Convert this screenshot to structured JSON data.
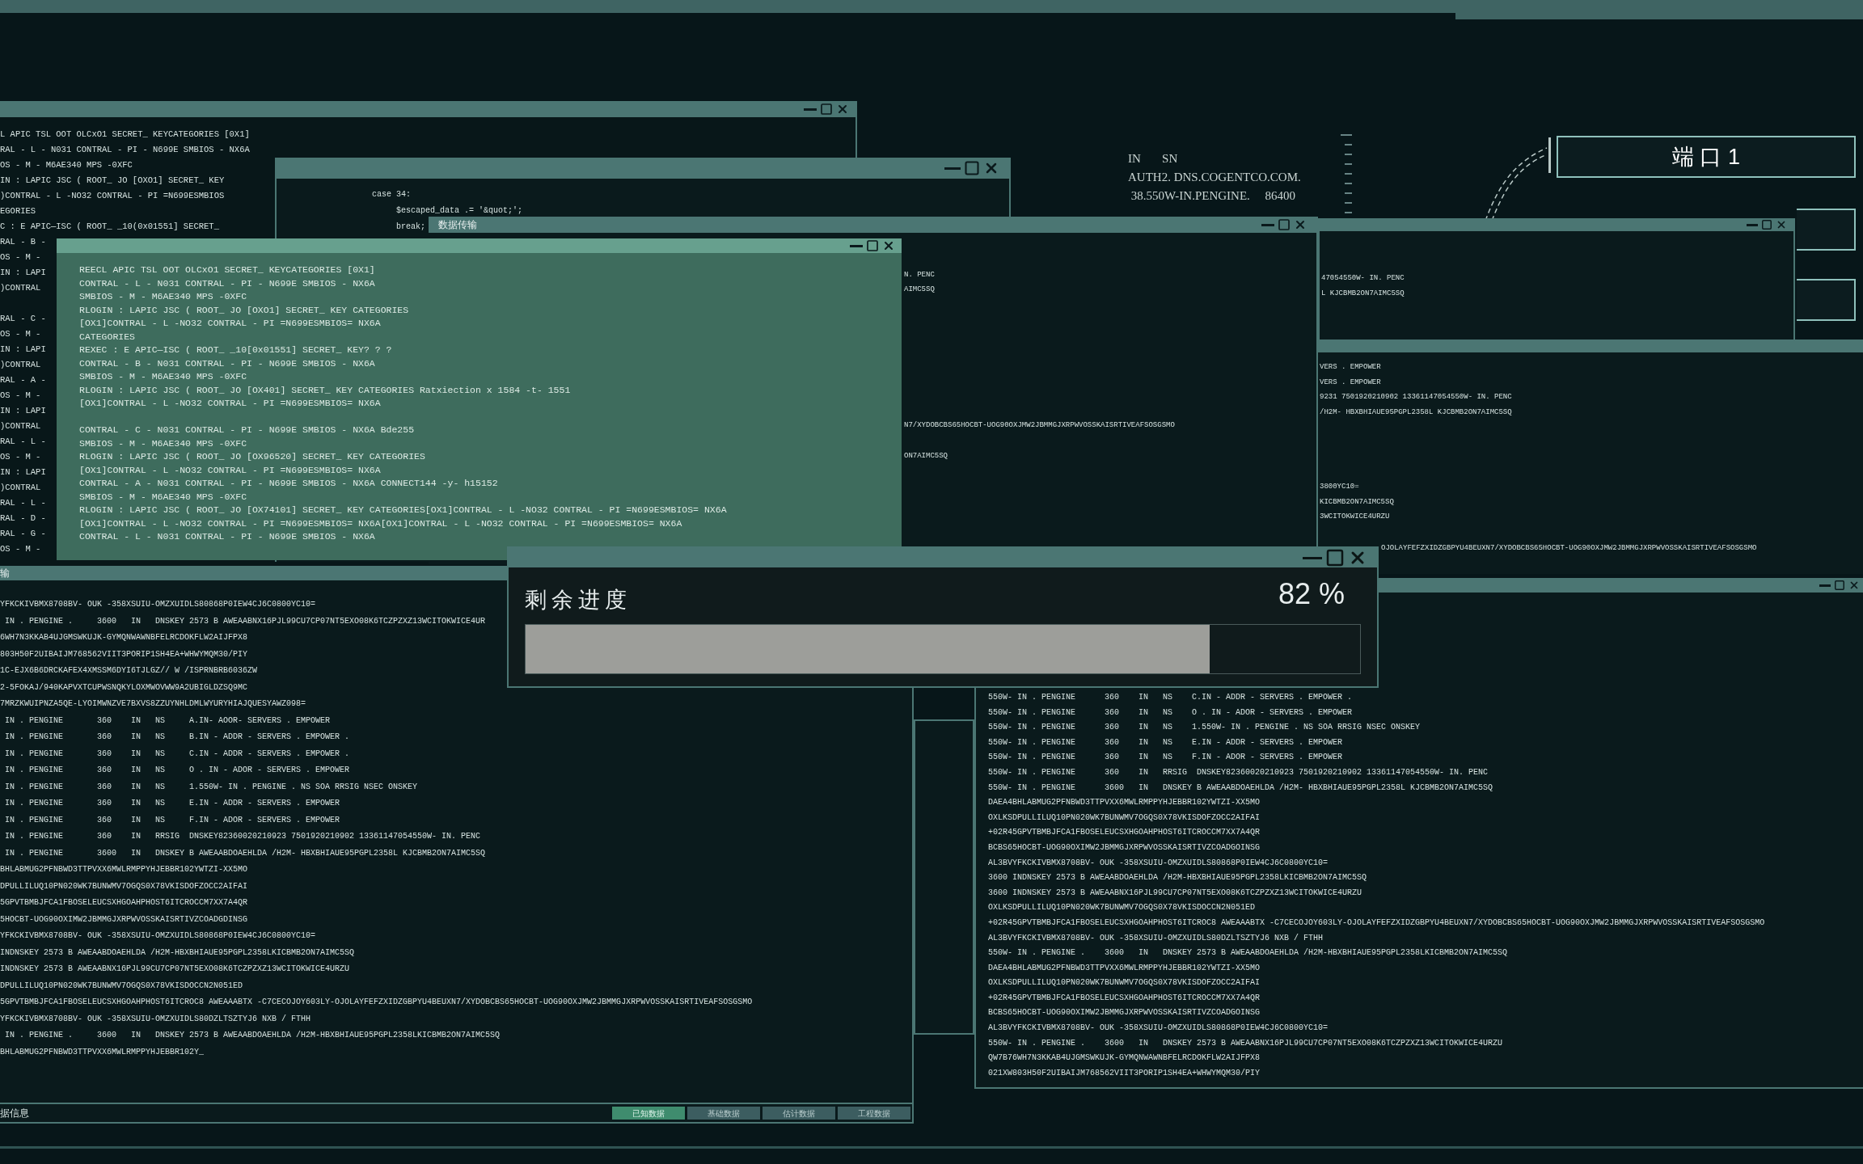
{
  "back_console": {
    "line_groups": [
      [
        "L APIC TSL OOT OLCxO1 SECRET_ KEYCATEGORIES [0X1]",
        "RAL - L - N031 CONTRAL - PI - N699E SMBIOS - NX6A",
        "OS - M - M6AE340 MPS -0XFC",
        "IN : LAPIC JSC ( ROOT_ JO [OXO1] SECRET_ KEY",
        ")CONTRAL - L -NO32 CONTRAL - PI =N699ESMBIOS",
        "EGORIES",
        "C : E APIC—ISC ( ROOT_ _10(0x01551] SECRET_",
        "RAL - B -",
        "OS - M -",
        "IN : LAPI",
        ")CONTRAL"
      ],
      [
        "RAL - C -",
        "OS - M -",
        "IN : LAPI",
        ")CONTRAL",
        "RAL - A -",
        "OS - M -",
        "IN : LAPI",
        ")CONTRAL",
        "RAL - L -",
        "OS - M -",
        "IN : LAPI",
        ")CONTRAL",
        "RAL - L -",
        "RAL - D -",
        "RAL - G -",
        "OS - M -"
      ]
    ]
  },
  "code_window": {
    "lines": [
      "case 34:",
      "     $escaped_data .= '&quot;';",
      "     break;"
    ]
  },
  "info_text": {
    "lines": [
      "IN       SN",
      "AUTH2. DNS.COGENTCO.COM.",
      " 38.550W-IN.PENGINE.     86400"
    ]
  },
  "port_panel": {
    "ports": [
      {
        "label": "端 口 1"
      }
    ]
  },
  "transfer_window": {
    "title": "数据传输",
    "line_groups": [
      [
        "N. PENC",
        "AIMC5SQ"
      ],
      [
        "N7/XYDOBCBS65HOCBT-UOG90OXJMW2JBMMGJXRPWVOSSKAISRTIVEAFSOSGSMO"
      ],
      [
        "ON7AIMC5SQ"
      ]
    ]
  },
  "upper_right_window": {
    "lines": [
      "47054550W- IN. PENC",
      "L KJCBMB2ON7AIMC5SQ"
    ]
  },
  "middle_right_window": {
    "line_groups": [
      [
        "VERS . EMPOWER",
        "VERS . EMPOWER",
        "9231 7501920210902 13361147054550W- IN. PENC",
        "/H2M- HBXBHIAUE95PGPL2358L KJCBMB2ON7AIMC5SQ"
      ],
      [
        "3800YC10=",
        "KICBMB2ON7AIMC5SQ",
        "3WCITOKWICE4URZU"
      ],
      [
        "OJOLAYFEFZXIDZGBPYU4BEUXN7/XYDOBCBS65HOCBT-UOG90OXJMW2JBMMGJXRPWVOSSKAISRTIVEAFSOSGSMO"
      ]
    ]
  },
  "green_console": {
    "line_groups": [
      [
        "REECL APIC TSL OOT OLCxO1 SECRET_ KEYCATEGORIES [0X1]",
        "CONTRAL - L - N031 CONTRAL - PI - N699E SMBIOS - NX6A",
        "SMBIOS - M - M6AE340 MPS -0XFC",
        "RLOGIN : LAPIC JSC ( ROOT_ JO [OXO1] SECRET_ KEY CATEGORIES",
        "[OX1]CONTRAL - L -NO32 CONTRAL - PI =N699ESMBIOS= NX6A",
        "CATEGORIES",
        "REXEC : E APIC—ISC ( ROOT_ _10[0x01551] SECRET_ KEY? ? ?",
        "CONTRAL - B - N031 CONTRAL - PI - N699E SMBIOS - NX6A",
        "SMBIOS - M - M6AE340 MPS -0XFC",
        "RLOGIN : LAPIC JSC ( ROOT_ JO [OX401] SECRET_ KEY CATEGORIES Ratxiection x 1584 -t- 1551",
        "[OX1]CONTRAL - L -NO32 CONTRAL - PI =N699ESMBIOS= NX6A"
      ],
      [
        "CONTRAL - C - N031 CONTRAL - PI - N699E SMBIOS - NX6A Bde255",
        "SMBIOS - M - M6AE340 MPS -0XFC",
        "RLOGIN : LAPIC JSC ( ROOT_ JO [OX96520] SECRET_ KEY CATEGORIES",
        "[OX1]CONTRAL - L -NO32 CONTRAL - PI =N699ESMBIOS= NX6A",
        "CONTRAL - A - N031 CONTRAL - PI - N699E SMBIOS - NX6A CONNECT144 -y- h15152",
        "SMBIOS - M - M6AE340 MPS -0XFC",
        "RLOGIN : LAPIC JSC ( ROOT_ JO [OX74101] SECRET_ KEY CATEGORIES[OX1]CONTRAL - L -NO32 CONTRAL - PI =N699ESMBIOS= NX6A",
        "[OX1]CONTRAL - L -NO32 CONTRAL - PI =N699ESMBIOS= NX6A[OX1]CONTRAL - L -NO32 CONTRAL - PI =N699ESMBIOS= NX6A",
        "CONTRAL - L - N031 CONTRAL - PI - N699E SMBIOS - NX6A"
      ]
    ]
  },
  "bottom_left_console": {
    "title": "输",
    "lines": [
      "YFKCKIVBMX8708BV- OUK -358XSUIU-OMZXUIDLS80868P0IEW4CJ6C0800YC10=",
      " IN . PENGINE .     3600   IN   DNSKEY 2573 B AWEAABNX16PJL99CU7CP07NT5EXO08K6TCZPZXZ13WCITOKWICE4UR",
      "6WH7N3KKAB4UJGMSWKUJK-GYMQNWAWNBFELRCDOKFLW2AIJFPX8",
      "803H50F2UIBAIJM768562VIIT3PORIP1SH4EA+WHWYMQM30/PIY",
      "1C-EJX6B6DRCKAFEX4XMSSM6DYI6TJLGZ// W /ISPRNBRB6036ZW",
      "2-5FOKAJ/940KAPVXTCUPWSNQKYLOXMWOVWW9A2UBIGLDZSQ9MC",
      "7MRZKWUIPNZA5QE-LYOIMWNZVE7BXVS8ZZUYNHLDMLWYURYHIAJQUESYAWZ098=",
      " IN . PENGINE       360    IN   NS     A.IN- AOOR- SERVERS . EMPOWER",
      " IN . PENGINE       360    IN   NS     B.IN - ADDR - SERVERS . EMPOWER .",
      " IN . PENGINE       360    IN   NS     C.IN - ADDR - SERVERS . EMPOWER .",
      " IN . PENGINE       360    IN   NS     O . IN - ADOR - SERVERS . EMPOWER",
      " IN . PENGINE       360    IN   NS     1.550W- IN . PENGINE . NS SOA RRSIG NSEC ONSKEY",
      " IN . PENGINE       360    IN   NS     E.IN - ADDR - SERVERS . EMPOWER",
      " IN . PENGINE       360    IN   NS     F.IN - ADOR - SERVERS . EMPOWER",
      " IN . PENGINE       360    IN   RRSIG  DNSKEY82360020210923 7501920210902 13361147054550W- IN. PENC",
      " IN . PENGINE       3600   IN   DNSKEY B AWEAABDOAEHLDA /H2M- HBXBHIAUE95PGPL2358L KJCBMB2ON7AIMC5SQ",
      "BHLABMUG2PFNBWD3TTPVXX6MWLRMPPYHJEBBR102YWTZI-XX5MO",
      "DPULLILUQ10PN020WK7BUNWMV7OGQS0X78VKISDOFZOCC2AIFAI",
      "5GPVTBMBJFCA1FBOSELEUCSXHGOAHPHOST6ITCROCCM7XX7A4QR",
      "5HOCBT-UOG90OXIMW2JBMMGJXRPWVOSSKAISRTIVZCOADGDINSG",
      "YFKCKIVBMX8708BV- OUK -358XSUIU-OMZXUIDLS80868P0IEW4CJ6C0800YC10=",
      "INDNSKEY 2573 B AWEAABDOAEHLDA /H2M-HBXBHIAUE95PGPL2358LKICBMB2ON7AIMC5SQ",
      "INDNSKEY 2573 B AWEAABNX16PJL99CU7CP07NT5EXO08K6TCZPZXZ13WCITOKWICE4URZU",
      "DPULLILUQ10PN020WK7BUNWMV7OGQS0X78VKISDOCCN2N051ED",
      "5GPVTBMBJFCA1FBOSELEUCSXHGOAHPHOST6ITCROC8 AWEAAABTX -C7CECOJOY603LY-OJOLAYFEFZXIDZGBPYU4BEUXN7/XYDOBCBS65HOCBT-UOG90OXJMW2JBMMGJXRPWVOSSKAISRTIVEAFSOSGSMO",
      "YFKCKIVBMX8708BV- OUK -358XSUIU-OMZXUIDLS80DZLTSZTYJ6 NXB / FTHH",
      " IN . PENGINE .     3600   IN   DNSKEY 2573 B AWEAABDOAEHLDA /H2M-HBXBHIAUE95PGPL2358LKICBMB2ON7AIMC5SQ",
      "BHLABMUG2PFNBWD3TTPVXX6MWLRMPPYHJEBBR102Y_"
    ],
    "footer": {
      "label": "据信息",
      "tabs": [
        {
          "label": "已知数据",
          "selected": true
        },
        {
          "label": "基础数据",
          "selected": false
        },
        {
          "label": "估计数据",
          "selected": false
        },
        {
          "label": "工程数据",
          "selected": false
        }
      ]
    }
  },
  "bottom_right_console": {
    "lines": [
      "550W- IN . PENGINE      360    IN   NS    C.IN - ADDR - SERVERS . EMPOWER .",
      "550W- IN . PENGINE      360    IN   NS    O . IN - ADOR - SERVERS . EMPOWER",
      "550W- IN . PENGINE      360    IN   NS    1.550W- IN . PENGINE . NS SOA RRSIG NSEC ONSKEY",
      "550W- IN . PENGINE      360    IN   NS    E.IN - ADDR - SERVERS . EMPOWER",
      "550W- IN . PENGINE      360    IN   NS    F.IN - ADOR - SERVERS . EMPOWER",
      "550W- IN . PENGINE      360    IN   RRSIG  DNSKEY82360020210923 7501920210902 13361147054550W- IN. PENC",
      "550W- IN . PENGINE      3600   IN   DNSKEY B AWEAABDOAEHLDA /H2M- HBXBHIAUE95PGPL2358L KJCBMB2ON7AIMC5SQ",
      "DAEA4BHLABMUG2PFNBWD3TTPVXX6MWLRMPPYHJEBBR102YWTZI-XX5MO",
      "OXLKSDPULLILUQ10PN020WK7BUNWMV7OGQS0X78VKISDOFZOCC2AIFAI",
      "+02R45GPVTBMBJFCA1FBOSELEUCSXHGOAHPHOST6ITCROCCM7XX7A4QR",
      "BCBS65HOCBT-UOG90OXIMW2JBMMGJXRPWVOSSKAISRTIVZCOADGOINSG",
      "AL3BVYFKCKIVBMX8708BV- OUK -358XSUIU-OMZXUIDLS80868P0IEW4CJ6C0800YC10=",
      "3600 INDNSKEY 2573 B AWEAABDOAEHLDA /H2M-HBXBHIAUE95PGPL2358LKICBMB2ON7AIMC5SQ",
      "3600 INDNSKEY 2573 B AWEAABNX16PJL99CU7CP07NT5EXO08K6TCZPZXZ13WCITOKWICE4URZU",
      "OXLKSDPULLILUQ10PN020WK7BUNWMV7OGQS0X78VKISDOCCN2N051ED",
      "+02R45GPVTBMBJFCA1FBOSELEUCSXHGOAHPHOST6ITCROC8 AWEAAABTX -C7CECOJOY603LY-OJOLAYFEFZXIDZGBPYU4BEUXN7/XYDOBCBS65HOCBT-UOG90OXJMW2JBMMGJXRPWVOSSKAISRTIVEAFSOSGSMO",
      "AL3BVYFKCKIVBMX8708BV- OUK -358XSUIU-OMZXUIDLS80DZLTSZTYJ6 NXB / FTHH",
      "550W- IN . PENGINE .    3600   IN   DNSKEY 2573 B AWEAABDOAEHLDA /H2M-HBXBHIAUE95PGPL2358LKICBMB2ON7AIMC5SQ",
      "DAEA4BHLABMUG2PFNBWD3TTPVXX6MWLRMPPYHJEBBR102YWTZI-XX5MO",
      "OXLKSDPULLILUQ10PN020WK7BUNWMV7OGQS0X78VKISDOFZOCC2AIFAI",
      "+02R45GPVTBMBJFCA1FBOSELEUCSXHGOAHPHOST6ITCROCCM7XX7A4QR",
      "BCBS65HOCBT-UOG90OXIMW2JBMMGJXRPWVOSSKAISRTIVZCOADGOINSG",
      "AL3BVYFKCKIVBMX8708BV- OUK -358XSUIU-OMZXUIDLS80868P0IEW4CJ6C0800YC10=",
      "550W- IN . PENGINE .    3600   IN   DNSKEY 2573 B AWEAABNX16PJL99CU7CP07NT5EXO08K6TCZPZXZ13WCITOKWICE4URZU",
      "QW7B76WH7N3KKAB4UJGMSWKUJK-GYMQNWAWNBFELRCDOKFLW2AIJFPX8",
      "021XW803H50F2UIBAIJM768562VIIT3PORIP1SH4EA+WHWYMQM30/PIY"
    ]
  },
  "progress_dialog": {
    "label": "剩余进度",
    "reading": "82 %",
    "level": 0.82
  }
}
